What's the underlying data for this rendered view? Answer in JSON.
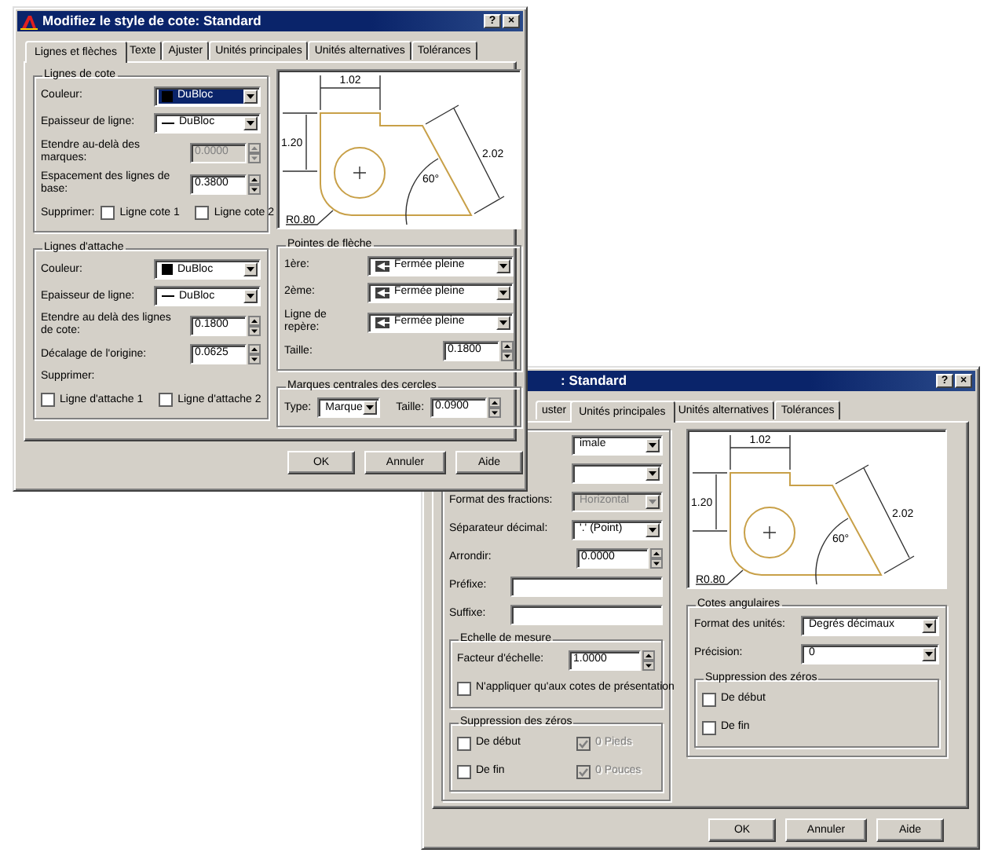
{
  "dialogs": [
    {
      "title": "Modifiez le style de cote: Standard",
      "help_button": "?",
      "close_button": "×",
      "tabs": [
        {
          "label": "Lignes et flèches",
          "selected": true
        },
        {
          "label": "Texte",
          "selected": false
        },
        {
          "label": "Ajuster",
          "selected": false
        },
        {
          "label": "Unités principales",
          "selected": false
        },
        {
          "label": "Unités alternatives",
          "selected": false
        },
        {
          "label": "Tolérances",
          "selected": false
        }
      ],
      "columns": [
        [
          {
            "kind": "group",
            "title": "Lignes de cote",
            "rows": [
              {
                "kind": "color_dropdown",
                "label": "Couleur:",
                "value": "DuBloc",
                "focused": true
              },
              {
                "kind": "lineweight_dropdown",
                "label": "Epaisseur de ligne:",
                "value": "DuBloc",
                "focused": false
              },
              {
                "kind": "spin",
                "label": "Etendre au-delà des marques:",
                "value": "0.0000",
                "disabled": true
              },
              {
                "kind": "spin",
                "label": "Espacement des lignes de base:",
                "value": "0.3800",
                "disabled": false
              },
              {
                "kind": "checks",
                "label": "Supprimer:",
                "items": [
                  {
                    "label": "Ligne cote 1",
                    "checked": false,
                    "disabled": false
                  },
                  {
                    "label": "Ligne cote 2",
                    "checked": false,
                    "disabled": false
                  }
                ]
              }
            ]
          },
          {
            "kind": "group",
            "title": "Lignes d'attache",
            "rows": [
              {
                "kind": "color_dropdown",
                "label": "Couleur:",
                "value": "DuBloc",
                "focused": false
              },
              {
                "kind": "lineweight_dropdown",
                "label": "Epaisseur de ligne:",
                "value": "DuBloc",
                "focused": false
              },
              {
                "kind": "spin",
                "label": "Etendre au delà des lignes de cote:",
                "value": "0.1800",
                "disabled": false
              },
              {
                "kind": "spin",
                "label": "Décalage de l'origine:",
                "value": "0.0625",
                "disabled": false
              },
              {
                "kind": "note",
                "text": "Supprimer:"
              },
              {
                "kind": "checks",
                "items": [
                  {
                    "label": "Ligne d'attache 1",
                    "checked": false,
                    "disabled": false
                  },
                  {
                    "label": "Ligne d'attache 2",
                    "checked": false,
                    "disabled": false
                  }
                ]
              }
            ]
          }
        ],
        [
          {
            "kind": "preview",
            "labels": [
              "1.02",
              "1.20",
              "2.02",
              "60°",
              "R0.80"
            ]
          },
          {
            "kind": "group",
            "title": "Pointes de flèche",
            "rows": [
              {
                "kind": "arrowhead_dropdown",
                "label": "1ère:",
                "value": "Fermée pleine",
                "focused": false
              },
              {
                "kind": "arrowhead_dropdown",
                "label": "2ème:",
                "value": "Fermée pleine",
                "focused": false
              },
              {
                "kind": "arrowhead_dropdown",
                "label": "Ligne de repère:",
                "value": "Fermée pleine",
                "focused": false
              },
              {
                "kind": "spin",
                "label": "Taille:",
                "value": "0.1800",
                "disabled": false
              }
            ]
          },
          {
            "kind": "group",
            "title": "Marques centrales des cercles",
            "rows": [
              {
                "kind": "inline",
                "items": [
                  {
                    "kind": "dropdown",
                    "label": "Type:",
                    "value": "Marque",
                    "focused": false
                  },
                  {
                    "kind": "spin",
                    "label": "Taille:",
                    "value": "0.0900",
                    "disabled": false
                  }
                ]
              }
            ]
          }
        ]
      ],
      "buttons": [
        "OK",
        "Annuler",
        "Aide"
      ]
    },
    {
      "title": ": Standard",
      "help_button": "?",
      "close_button": "×",
      "tabs": [
        {
          "label": "uster",
          "selected": false
        },
        {
          "label": "Unités principales",
          "selected": true
        },
        {
          "label": "Unités alternatives",
          "selected": false
        },
        {
          "label": "Tolérances",
          "selected": false
        }
      ],
      "columns": [
        [
          {
            "kind": "group",
            "rows": [
              {
                "kind": "dropdown",
                "value": "imale",
                "focused": false
              },
              {
                "kind": "dropdown",
                "focused": false
              },
              {
                "kind": "dropdown",
                "label": "Format des fractions:",
                "value": "Horizontal",
                "disabled": true,
                "focused": false
              },
              {
                "kind": "dropdown",
                "label": "Séparateur décimal:",
                "value": "'.' (Point)",
                "disabled": false,
                "focused": false
              },
              {
                "kind": "spin",
                "label": "Arrondir:",
                "value": "0.0000",
                "disabled": false
              },
              {
                "kind": "input",
                "label": "Préfixe:"
              },
              {
                "kind": "input",
                "label": "Suffixe:"
              },
              {
                "kind": "group",
                "title": "Echelle de mesure",
                "rows": [
                  {
                    "kind": "spin",
                    "label": "Facteur d'échelle:",
                    "value": "1.0000",
                    "disabled": false
                  },
                  {
                    "kind": "checks",
                    "items": [
                      {
                        "label": "N'appliquer qu'aux cotes de présentation",
                        "checked": false,
                        "disabled": false
                      }
                    ]
                  }
                ]
              },
              {
                "kind": "group",
                "title": "Suppression des zéros",
                "rows": [
                  {
                    "kind": "checks",
                    "items": [
                      {
                        "label": "De début",
                        "checked": false,
                        "disabled": false
                      },
                      {
                        "label": "0 Pieds",
                        "checked": true,
                        "disabled": true
                      }
                    ]
                  },
                  {
                    "kind": "checks",
                    "items": [
                      {
                        "label": "De fin",
                        "checked": false,
                        "disabled": false
                      },
                      {
                        "label": "0 Pouces",
                        "checked": true,
                        "disabled": true
                      }
                    ]
                  }
                ]
              }
            ]
          }
        ],
        [
          {
            "kind": "preview",
            "labels": [
              "1.02",
              "1.20",
              "2.02",
              "60°",
              "R0.80"
            ]
          },
          {
            "kind": "group",
            "title": "Cotes angulaires",
            "rows": [
              {
                "kind": "dropdown",
                "label": "Format des unités:",
                "value": "Degrés décimaux",
                "focused": false
              },
              {
                "kind": "dropdown",
                "label": "Précision:",
                "value": "0",
                "focused": false
              },
              {
                "kind": "group",
                "title": "Suppression des zéros",
                "rows": [
                  {
                    "kind": "checks",
                    "items": [
                      {
                        "label": "De début",
                        "checked": false,
                        "disabled": false
                      }
                    ]
                  },
                  {
                    "kind": "checks",
                    "items": [
                      {
                        "label": "De fin",
                        "checked": false,
                        "disabled": false
                      }
                    ]
                  }
                ]
              }
            ]
          }
        ]
      ],
      "buttons": [
        "OK",
        "Annuler",
        "Aide"
      ]
    }
  ]
}
